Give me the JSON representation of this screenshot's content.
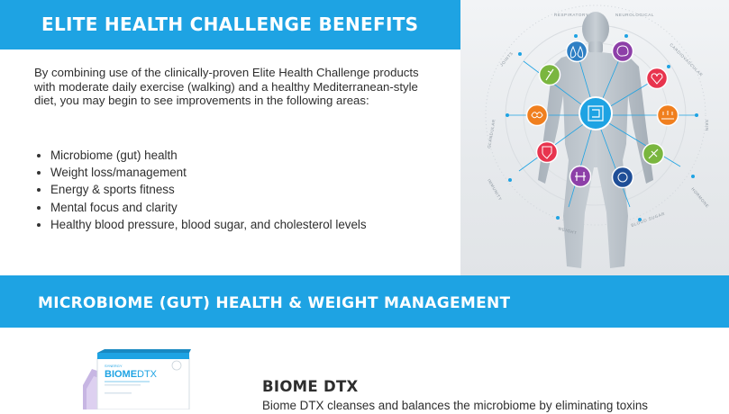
{
  "header": {
    "title": "ELITE HEALTH CHALLENGE BENEFITS"
  },
  "intro": "By combining use of the clinically-proven Elite Health Challenge products with moderate daily exercise (walking) and a healthy Mediterranean-style diet, you may begin to see improvements in the following areas:",
  "benefits": [
    "Microbiome (gut) health",
    "Weight loss/management",
    "Energy & sports fitness",
    "Mental focus and clarity",
    "Healthy blood pressure, blood sugar, and cholesterol levels"
  ],
  "figure": {
    "labels": [
      "RESPIRATORY",
      "NEUROLOGICAL",
      "CARDIOVASCULAR",
      "SKIN",
      "HORMONE",
      "BLOOD SUGAR",
      "WEIGHT",
      "IMMUNITY",
      "GLANDULAR",
      "JOINTS"
    ],
    "icons": [
      {
        "name": "lungs-icon",
        "color": "#2e7fc4"
      },
      {
        "name": "brain-icon",
        "color": "#8d3fa8"
      },
      {
        "name": "heart-icon",
        "color": "#e8344e"
      },
      {
        "name": "skin-icon",
        "color": "#f07f1e"
      },
      {
        "name": "hormone-icon",
        "color": "#7ab63f"
      },
      {
        "name": "blood-sugar-icon",
        "color": "#1f4e97"
      },
      {
        "name": "weight-icon",
        "color": "#8d3fa8"
      },
      {
        "name": "immunity-icon",
        "color": "#e8344e"
      },
      {
        "name": "glandular-icon",
        "color": "#f07f1e"
      },
      {
        "name": "joints-icon",
        "color": "#7ab63f"
      },
      {
        "name": "gut-icon",
        "color": "#1ea3e3"
      }
    ]
  },
  "section2": {
    "title": "MICROBIOME (GUT) HEALTH  &  WEIGHT MANAGEMENT"
  },
  "product": {
    "brand": "SYNERGY",
    "name_part1": "BIOME",
    "name_part2": "DTX",
    "title": "BIOME DTX",
    "description": "Biome DTX cleanses and balances the microbiome by eliminating toxins"
  },
  "colors": {
    "accent": "#1ea3e3"
  }
}
